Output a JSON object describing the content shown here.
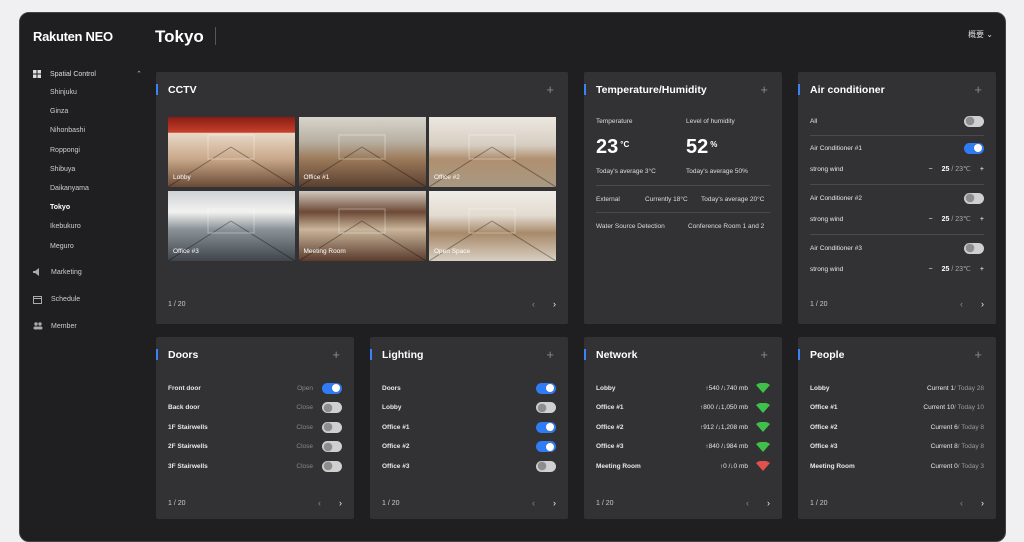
{
  "app": {
    "logo": "Rakuten NEO",
    "lang": "概要 ⌄"
  },
  "page_title": "Tokyo",
  "sidebar": {
    "group": {
      "label": "Spatial Control",
      "chevron": "⌃"
    },
    "sub_items": [
      "Shinjuku",
      "Ginza",
      "Nihonbashi",
      "Roppongi",
      "Shibuya",
      "Daikanyama",
      "Tokyo",
      "Ikebukuro",
      "Meguro"
    ],
    "active_sub": "Tokyo",
    "items": [
      {
        "label": "Marketing",
        "icon": "megaphone-icon"
      },
      {
        "label": "Schedule",
        "icon": "calendar-icon"
      },
      {
        "label": "Member",
        "icon": "people-icon"
      }
    ]
  },
  "cctv": {
    "title": "CCTV",
    "plus": "+",
    "cameras": [
      "Lobby",
      "Office #1",
      "Office #2",
      "Office #3",
      "Meeting Room",
      "Open Space"
    ],
    "page": "1 / 20"
  },
  "temp": {
    "title": "Temperature/Humidity",
    "plus": "+",
    "temperature_label": "Temperature",
    "temperature_value": "23",
    "temperature_unit": "°C",
    "temperature_avg": "Today's average 3°C",
    "humidity_label": "Level of humidity",
    "humidity_value": "52",
    "humidity_unit": "%",
    "humidity_avg": "Today's average 50%",
    "external_label": "External",
    "external_current": "Currently 18°C",
    "external_avg": "Today's average 20°C",
    "water_label": "Water Source Detection",
    "water_value": "Conference Room 1 and 2"
  },
  "ac": {
    "title": "Air conditioner",
    "plus": "+",
    "all_label": "All",
    "all_on": false,
    "units": [
      {
        "name": "Air Conditioner #1",
        "on": true,
        "mode": "strong wind",
        "temp": "25",
        "target": " / 23℃"
      },
      {
        "name": "Air Conditioner #2",
        "on": false,
        "mode": "strong wind",
        "temp": "25",
        "target": " / 23℃"
      },
      {
        "name": "Air Conditioner #3",
        "on": false,
        "mode": "strong wind",
        "temp": "25",
        "target": " / 23℃"
      }
    ],
    "minus": "−",
    "plus_ctrl": "+",
    "page": "1 / 20"
  },
  "doors": {
    "title": "Doors",
    "plus": "+",
    "rows": [
      {
        "name": "Front door",
        "state": "Open",
        "on": true
      },
      {
        "name": "Back door",
        "state": "Close",
        "on": false
      },
      {
        "name": "1F Stairwells",
        "state": "Close",
        "on": false
      },
      {
        "name": "2F Stairwells",
        "state": "Close",
        "on": false
      },
      {
        "name": "3F Stairwells",
        "state": "Close",
        "on": false
      }
    ],
    "page": "1 / 20"
  },
  "lighting": {
    "title": "Lighting",
    "plus": "+",
    "rows": [
      {
        "name": "Doors",
        "on": true
      },
      {
        "name": "Lobby",
        "on": false
      },
      {
        "name": "Office #1",
        "on": true
      },
      {
        "name": "Office #2",
        "on": true
      },
      {
        "name": "Office #3",
        "on": false
      }
    ],
    "page": "1 / 20"
  },
  "network": {
    "title": "Network",
    "plus": "+",
    "rows": [
      {
        "name": "Lobby",
        "value": "↑540 /↓740 mb",
        "color": "#3ec04a"
      },
      {
        "name": "Office #1",
        "value": "↑800 /↓1,050 mb",
        "color": "#3ec04a"
      },
      {
        "name": "Office #2",
        "value": "↑912 /↓1,208 mb",
        "color": "#3ec04a"
      },
      {
        "name": "Office #3",
        "value": "↑840 /↓984 mb",
        "color": "#3ec04a"
      },
      {
        "name": "Meeting Room",
        "value": "↑0 /↓0 mb",
        "color": "#e2514b"
      }
    ],
    "page": "1 / 20"
  },
  "people": {
    "title": "People",
    "plus": "+",
    "rows": [
      {
        "name": "Lobby",
        "current": "Current 1",
        "today": " / Today 28"
      },
      {
        "name": "Office #1",
        "current": "Current 10",
        "today": " / Today 10"
      },
      {
        "name": "Office #2",
        "current": "Current 6",
        "today": " / Today 8"
      },
      {
        "name": "Office #3",
        "current": "Current 8",
        "today": " / Today 8"
      },
      {
        "name": "Meeting Room",
        "current": "Current 0",
        "today": " / Today 3"
      }
    ],
    "page": "1 / 20"
  },
  "pager": {
    "prev": "‹",
    "next": "›"
  },
  "colors": {
    "accent": "#3b82f6",
    "toggle_on": "#2f7cf6",
    "card": "#323234",
    "bg": "#1f1f21"
  }
}
